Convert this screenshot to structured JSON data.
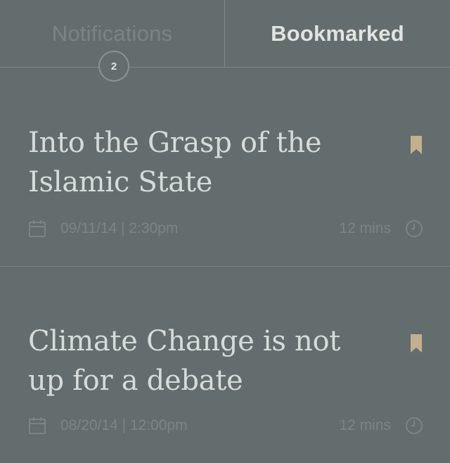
{
  "tabs": {
    "notifications": {
      "label": "Notifications",
      "badge": "2"
    },
    "bookmarked": {
      "label": "Bookmarked"
    }
  },
  "colors": {
    "background": "#646d6d",
    "active_tab": "#dfe4e1",
    "inactive_text": "#7b8484",
    "bookmark_accent": "#c2b08f"
  },
  "articles": [
    {
      "title": "Into the Grasp of the Islamic State",
      "datetime": "09/11/14 | 2:30pm",
      "read_time": "12 mins",
      "icons": [
        "bookmark-icon",
        "calendar-icon",
        "clock-icon"
      ]
    },
    {
      "title": "Climate Change is not up for a debate",
      "datetime": "08/20/14 | 12:00pm",
      "read_time": "12 mins",
      "icons": [
        "bookmark-icon",
        "calendar-icon",
        "clock-icon"
      ]
    }
  ]
}
